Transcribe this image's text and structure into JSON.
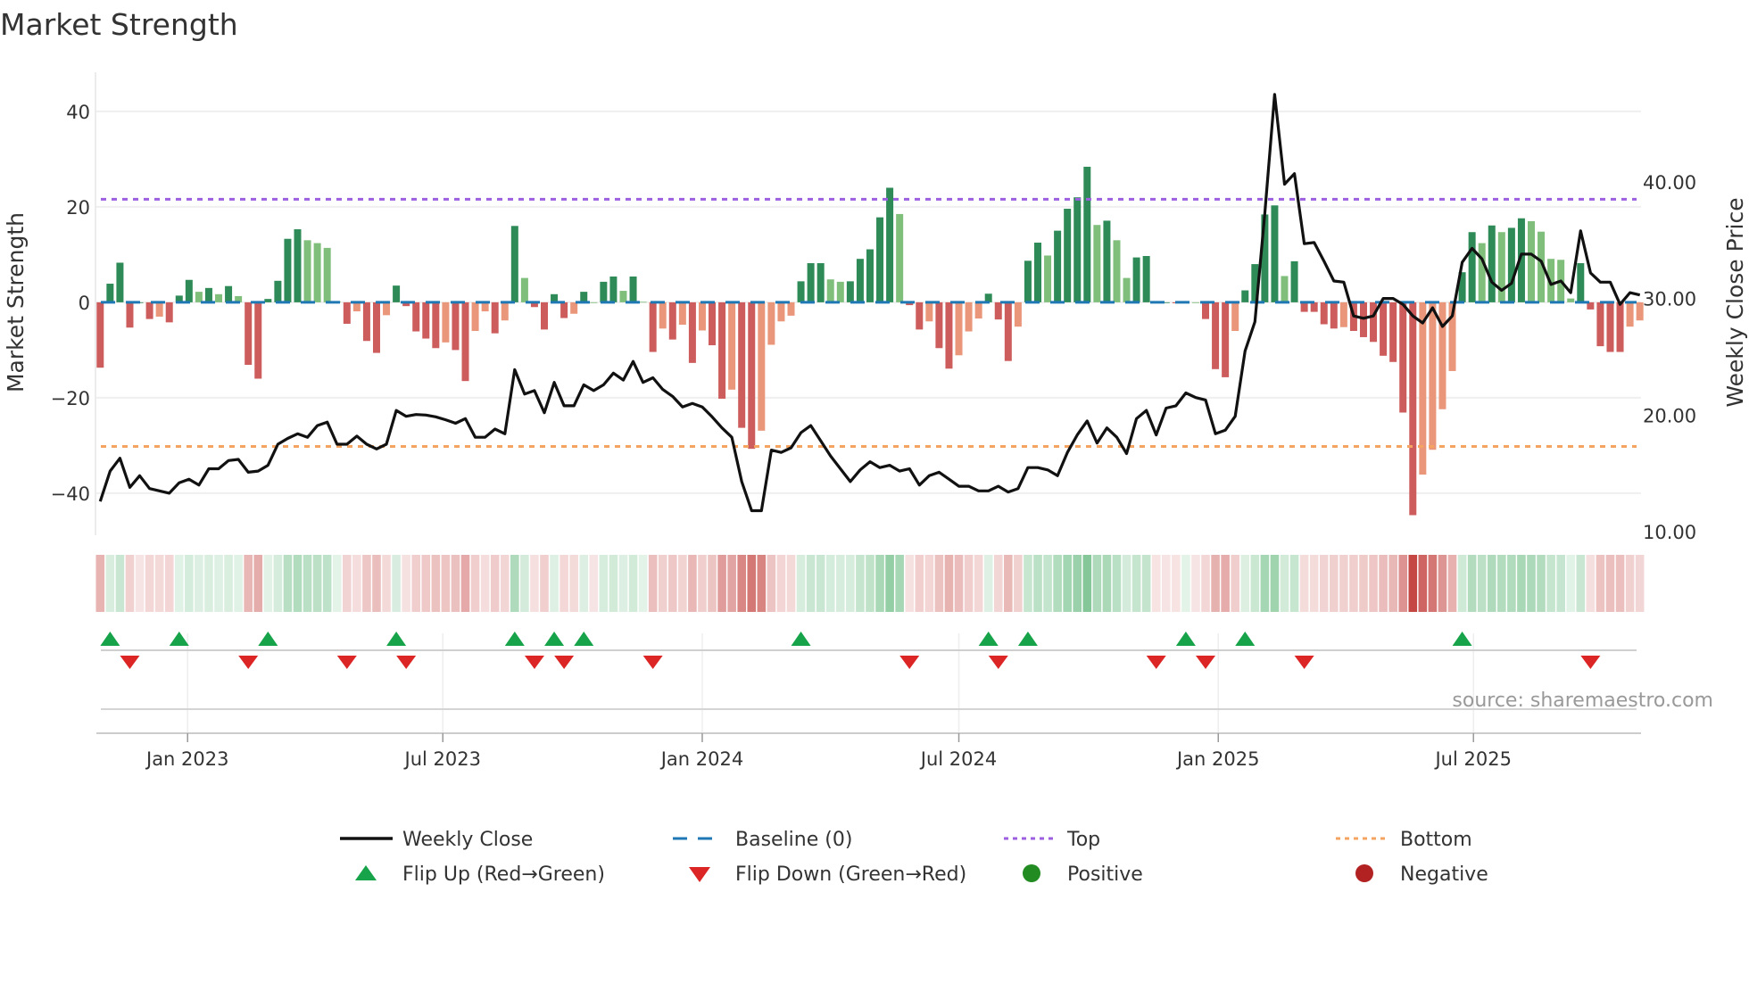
{
  "title": "Market Strength",
  "source": "source: sharemaestro.com",
  "chart_data": {
    "type": "bar+line",
    "x_start": "2022-10-31",
    "x_interval_days": 7,
    "left_axis": {
      "label": "Market Strength",
      "range": [
        -48.8,
        48.2
      ],
      "ticks": [
        40,
        20,
        0,
        -20,
        -40
      ],
      "tick_labels": [
        "40",
        "20",
        "0",
        "−20",
        "−40"
      ]
    },
    "right_axis": {
      "label": "Weekly Close Price",
      "range": [
        9.7,
        49.4
      ],
      "ticks": [
        40,
        30,
        20,
        10
      ],
      "tick_labels": [
        "40.00",
        "30.00",
        "20.00",
        "10.00"
      ]
    },
    "x_ticks": [
      {
        "date": "2023-01-01",
        "label": "Jan 2023"
      },
      {
        "date": "2023-07-01",
        "label": "Jul 2023"
      },
      {
        "date": "2024-01-01",
        "label": "Jan 2024"
      },
      {
        "date": "2024-07-01",
        "label": "Jul 2024"
      },
      {
        "date": "2025-01-01",
        "label": "Jan 2025"
      },
      {
        "date": "2025-07-01",
        "label": "Jul 2025"
      }
    ],
    "baseline": 0,
    "top": 21.6,
    "bottom": -30.2,
    "series": [
      {
        "name": "Market Strength",
        "axis": "left",
        "values": [
          -13.7,
          3.9,
          8.3,
          -5.3,
          0,
          -3.5,
          -3.0,
          -4.2,
          1.4,
          4.7,
          2.2,
          3.0,
          1.7,
          3.4,
          1.3,
          -13.1,
          -16.0,
          0.7,
          4.5,
          13.3,
          15.3,
          13.0,
          12.4,
          11.4,
          0.2,
          -4.5,
          -1.9,
          -8.1,
          -10.6,
          -2.7,
          3.5,
          -0.8,
          -6.1,
          -7.6,
          -9.6,
          -8.4,
          -10.0,
          -16.5,
          -6.0,
          -1.9,
          -6.5,
          -3.8,
          16.0,
          5.1,
          -1.0,
          -5.7,
          1.7,
          -3.3,
          -2.4,
          2.2,
          0,
          4.3,
          5.4,
          2.4,
          5.4,
          0.1,
          -10.4,
          -5.5,
          -7.8,
          -4.7,
          -12.7,
          -5.9,
          -9.0,
          -20.2,
          -18.3,
          -26.3,
          -30.7,
          -26.9,
          -8.9,
          -4.0,
          -2.8,
          4.4,
          8.2,
          8.2,
          4.8,
          4.3,
          4.4,
          9.1,
          11.1,
          17.8,
          24.0,
          18.5,
          -0.6,
          -5.7,
          -4.0,
          -9.6,
          -13.9,
          -11.1,
          -6.1,
          -3.4,
          1.8,
          -3.6,
          -12.3,
          -5.1,
          8.7,
          12.5,
          9.8,
          15.0,
          19.6,
          22.0,
          28.4,
          16.2,
          17.1,
          13.0,
          5.1,
          9.4,
          9.7,
          -0.2,
          0,
          -0.2,
          0.2,
          0,
          -3.5,
          -14.0,
          -15.7,
          -6.0,
          2.5,
          8.0,
          18.4,
          20.3,
          5.5,
          8.6,
          -2.0,
          -2.0,
          -4.6,
          -5.5,
          -5.2,
          -6.0,
          -7.3,
          -8.3,
          -11.2,
          -12.5,
          -23.1,
          -44.6,
          -36.1,
          -30.9,
          -22.4,
          -14.4,
          6.3,
          14.7,
          12.4,
          16.1,
          14.7,
          15.6,
          17.6,
          17.0,
          14.8,
          9.1,
          8.9,
          0.8,
          8.2,
          -1.5,
          -9.2,
          -10.4,
          -10.4,
          -5.1,
          -3.8
        ]
      },
      {
        "name": "Weekly Close",
        "axis": "right",
        "values": [
          12.6,
          15.2,
          16.3,
          13.8,
          14.8,
          13.7,
          13.5,
          13.3,
          14.2,
          14.5,
          14.0,
          15.4,
          15.4,
          16.1,
          16.2,
          15.1,
          15.2,
          15.7,
          17.5,
          18.0,
          18.4,
          18.1,
          19.1,
          19.4,
          17.5,
          17.5,
          18.2,
          17.5,
          17.1,
          17.5,
          20.4,
          19.9,
          20.05,
          20.0,
          19.85,
          19.6,
          19.3,
          19.7,
          18.1,
          18.1,
          18.8,
          18.4,
          23.9,
          21.8,
          22.1,
          20.2,
          22.8,
          20.8,
          20.8,
          22.6,
          22.1,
          22.6,
          23.6,
          23.0,
          24.6,
          22.8,
          23.2,
          22.2,
          21.6,
          20.7,
          21.0,
          20.7,
          19.85,
          18.9,
          18.1,
          14.3,
          11.8,
          11.8,
          17.0,
          16.8,
          17.2,
          18.5,
          19.1,
          17.8,
          16.5,
          15.4,
          14.3,
          15.3,
          16.0,
          15.5,
          15.7,
          15.2,
          15.4,
          14.0,
          14.8,
          15.1,
          14.5,
          13.9,
          13.9,
          13.5,
          13.5,
          13.9,
          13.4,
          13.7,
          15.5,
          15.5,
          15.3,
          14.8,
          16.8,
          18.3,
          19.5,
          17.6,
          18.9,
          18.1,
          16.7,
          19.7,
          20.4,
          18.3,
          20.6,
          20.8,
          21.9,
          21.5,
          21.3,
          18.4,
          18.7,
          19.9,
          25.5,
          28.0,
          37.3,
          47.5,
          39.8,
          40.7,
          34.7,
          34.8,
          33.2,
          31.5,
          31.4,
          28.5,
          28.3,
          28.5,
          30.0,
          30.0,
          29.5,
          28.5,
          27.9,
          29.2,
          27.6,
          28.5,
          33.1,
          34.3,
          33.4,
          31.4,
          30.7,
          31.3,
          33.8,
          33.8,
          33.2,
          31.2,
          31.5,
          30.5,
          35.8,
          32.2,
          31.4,
          31.4,
          29.5,
          30.5,
          30.3
        ]
      }
    ],
    "flip_up_indices": [
      1,
      8,
      17,
      30,
      42,
      46,
      49,
      71,
      90,
      94,
      110,
      116,
      138
    ],
    "flip_down_indices": [
      3,
      15,
      25,
      31,
      44,
      47,
      56,
      82,
      91,
      107,
      112,
      122,
      151
    ],
    "colors": {
      "positive_rising": "#2e8b57",
      "positive_falling": "#7fbf7b",
      "negative_falling": "#cd5c5c",
      "negative_rising": "#e9967a",
      "line": "#111111",
      "baseline": "#1f77b4",
      "top": "#9b5fe0",
      "bottom": "#f4a460",
      "flip_up": "#17a34a",
      "flip_down": "#dc2626",
      "positive_dot": "#228b22",
      "negative_dot": "#b22222"
    }
  },
  "legend": [
    {
      "label": "Weekly Close",
      "icon": "line-icon"
    },
    {
      "label": "Baseline (0)",
      "icon": "dashed-line-icon"
    },
    {
      "label": "Top",
      "icon": "dotted-line-icon"
    },
    {
      "label": "Bottom",
      "icon": "dotted-line-icon"
    },
    {
      "label": "Flip Up (Red→Green)",
      "icon": "triangle-up-icon"
    },
    {
      "label": "Flip Down (Green→Red)",
      "icon": "triangle-down-icon"
    },
    {
      "label": "Positive",
      "icon": "circle-icon"
    },
    {
      "label": "Negative",
      "icon": "circle-icon"
    }
  ]
}
